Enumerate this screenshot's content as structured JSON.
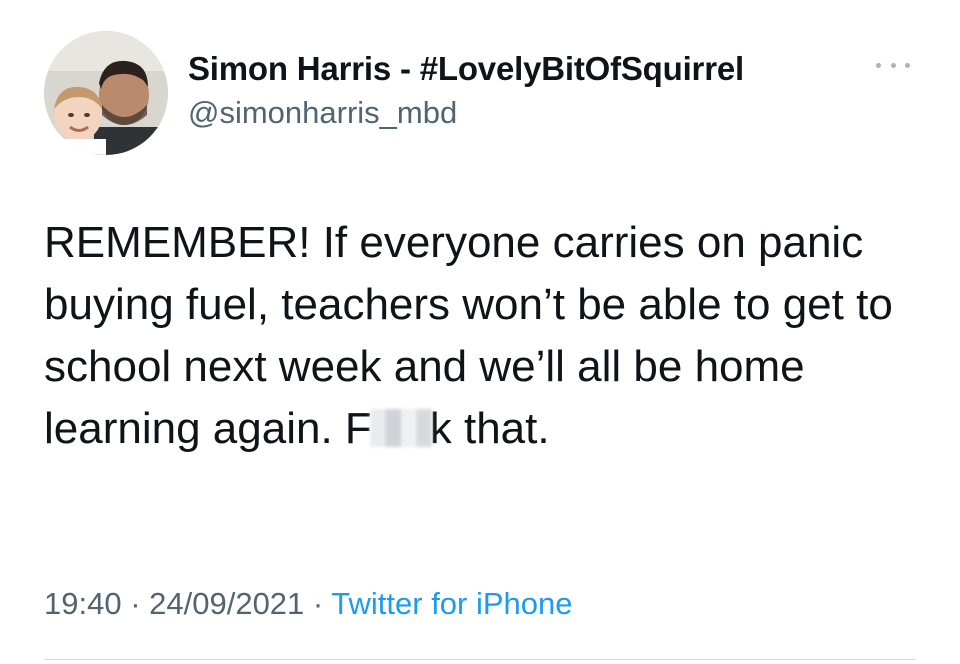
{
  "colors": {
    "text_primary": "#0f1419",
    "text_secondary": "#536471",
    "link_blue": "#1d9bf0",
    "divider": "#cfd9de"
  },
  "author": {
    "display_name": "Simon Harris - #LovelyBitOfSquirrel",
    "handle": "@simonharris_mbd",
    "avatar_icon": "profile-photo"
  },
  "menu": {
    "icon": "more-horizontal-icon"
  },
  "tweet": {
    "text_part1": "REMEMBER! If everyone carries on panic buying fuel, teachers won’t be able to get to school next week and we’ll all be home learning again. F",
    "text_part2": "k that."
  },
  "meta": {
    "time": "19:40",
    "separator1": " · ",
    "date": "24/09/2021",
    "separator2": " · ",
    "source": "Twitter for iPhone"
  }
}
